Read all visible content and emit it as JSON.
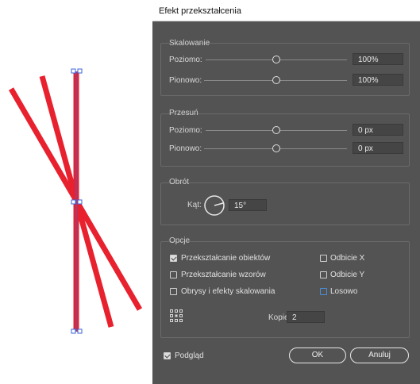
{
  "dialog": {
    "title": "Efekt przekształcenia",
    "scaling": {
      "header": "Skalowanie",
      "horizontal": {
        "label": "Poziomo:",
        "value": "100%"
      },
      "vertical": {
        "label": "Pionowo:",
        "value": "100%"
      }
    },
    "move": {
      "header": "Przesuń",
      "horizontal": {
        "label": "Poziomo:",
        "value": "0 px"
      },
      "vertical": {
        "label": "Pionowo:",
        "value": "0 px"
      }
    },
    "rotate": {
      "header": "Obrót",
      "angle_label": "Kąt:",
      "angle_value": "15°"
    },
    "options": {
      "header": "Opcje",
      "transform_objects": {
        "label": "Przekształcanie obiektów",
        "checked": true
      },
      "transform_patterns": {
        "label": "Przekształcanie wzorów",
        "checked": false
      },
      "scale_strokes_effects": {
        "label": "Obrysy i efekty skalowania",
        "checked": false
      },
      "reflect_x": {
        "label": "Odbicie X",
        "checked": false
      },
      "reflect_y": {
        "label": "Odbicie Y",
        "checked": false
      },
      "random": {
        "label": "Losowo",
        "checked": false
      }
    },
    "copies": {
      "label": "Kopie",
      "value": "2"
    },
    "preview": {
      "label": "Podgląd",
      "checked": true
    },
    "ok_label": "OK",
    "cancel_label": "Anuluj"
  },
  "colors": {
    "stroke_red": "#e8212e",
    "dialog_bg": "#535353",
    "selection_blue": "#3b63d9"
  }
}
